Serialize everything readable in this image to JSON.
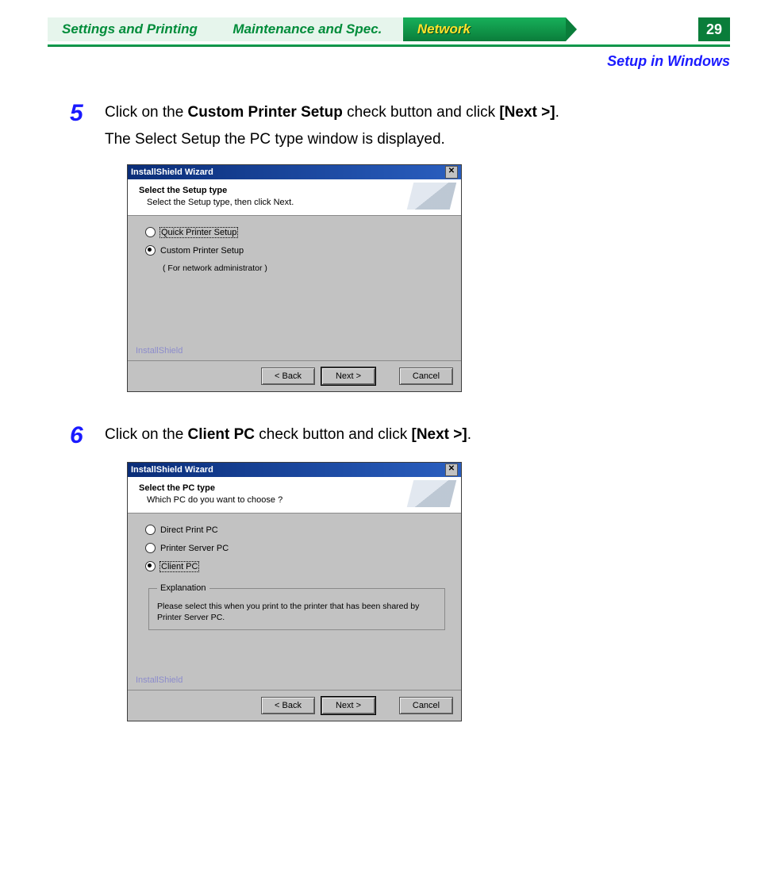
{
  "tabs": {
    "settings": "Settings and Printing",
    "maintenance": "Maintenance and Spec.",
    "network": "Network"
  },
  "page_number": "29",
  "subheading": "Setup in Windows",
  "steps": {
    "s5": {
      "num": "5",
      "pre": "Click on the ",
      "bold1": "Custom Printer Setup",
      "mid": " check button and click ",
      "bold2": "[Next >]",
      "post": ".",
      "sub": "The Select Setup the PC type window is displayed."
    },
    "s6": {
      "num": "6",
      "pre": "Click on the ",
      "bold1": "Client PC",
      "mid": " check button and click ",
      "bold2": "[Next >]",
      "post": "."
    }
  },
  "wizard1": {
    "title": "InstallShield Wizard",
    "banner_title": "Select the Setup type",
    "banner_sub": "Select the Setup type, then click Next.",
    "opt_quick": "Quick Printer Setup",
    "opt_custom": "Custom Printer Setup",
    "opt_custom_hint": "( For network administrator )",
    "brand": "InstallShield",
    "btn_back": "< Back",
    "btn_next": "Next >",
    "btn_cancel": "Cancel"
  },
  "wizard2": {
    "title": "InstallShield Wizard",
    "banner_title": "Select the PC type",
    "banner_sub": "Which PC do you want to choose ?",
    "opt_direct": "Direct Print PC",
    "opt_server": "Printer Server PC",
    "opt_client": "Client PC",
    "expl_legend": "Explanation",
    "expl_text": "Please select this when you print to the printer that has been shared by Printer Server PC.",
    "brand": "InstallShield",
    "btn_back": "< Back",
    "btn_next": "Next >",
    "btn_cancel": "Cancel"
  }
}
